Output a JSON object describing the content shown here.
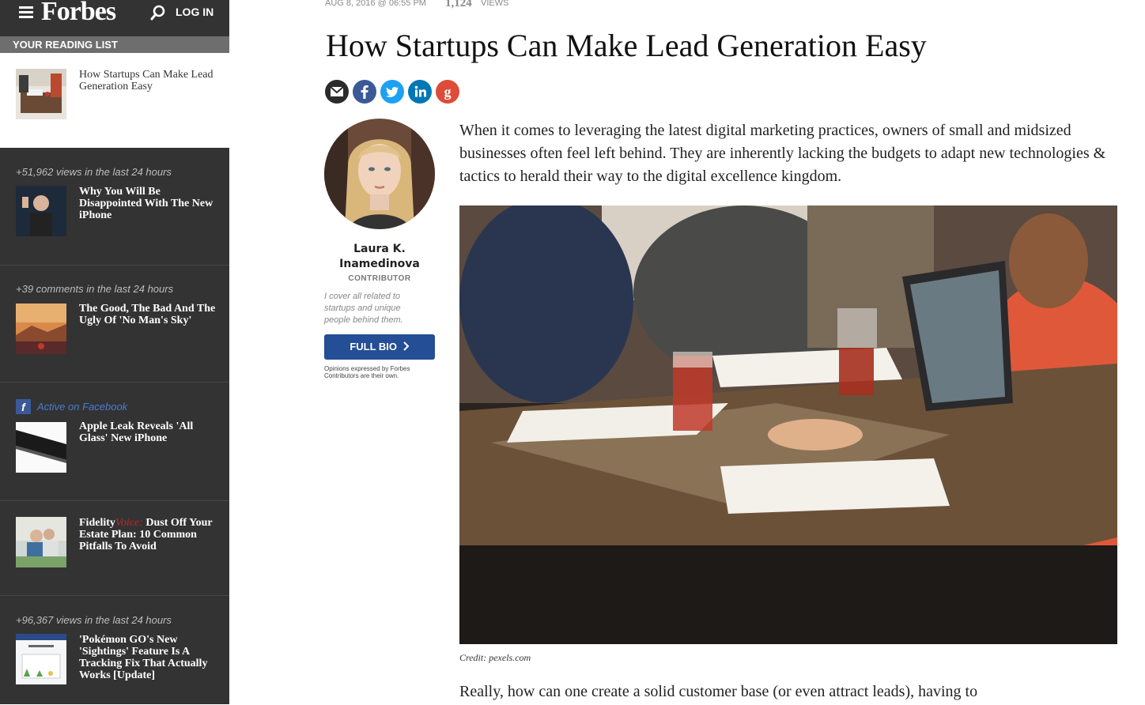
{
  "sidebar": {
    "logo": "Forbes",
    "login_label": "LOG IN",
    "reading_list_header": "YOUR READING LIST",
    "reading_list_item": "How Startups Can Make Lead Generation Easy",
    "sections": [
      {
        "meta": "+51,962 views in the last 24 hours",
        "title": "Why You Will Be Disappointed With The New iPhone"
      },
      {
        "meta": "+39 comments in the last 24 hours",
        "title": "The Good, The Bad And The Ugly Of 'No Man's Sky'"
      },
      {
        "meta": "Active on Facebook",
        "title": "Apple Leak Reveals 'All Glass' New iPhone"
      },
      {
        "title_brand": "Fidelity",
        "title_voice": "Voice:",
        "title_rest": " Dust Off Your Estate Plan: 10 Common Pitfalls To Avoid"
      },
      {
        "meta": "+96,367 views in the last 24 hours",
        "title": "'Pokémon GO's New 'Sightings' Feature Is A Tracking Fix That Actually Works [Update]"
      }
    ]
  },
  "article": {
    "date": "AUG 8, 2016 @ 06:55 PM",
    "views_count": "1,124",
    "views_label": "VIEWS",
    "headline": "How Startups Can Make Lead Generation Easy",
    "share_buttons": [
      "email-icon",
      "facebook-icon",
      "twitter-icon",
      "linkedin-icon",
      "google-plus-icon"
    ],
    "author": {
      "name_line1": "Laura K.",
      "name_line2": "Inamedinova",
      "role": "CONTRIBUTOR",
      "bio": "I cover all related to startups and unique people behind them.",
      "full_bio_label": "FULL BIO",
      "disclaimer": "Opinions expressed by Forbes Contributors are their own."
    },
    "intro": "When it comes to leveraging the latest digital marketing practices, owners of small and midsized businesses often feel left behind. They are inherently lacking the budgets to adapt new technologies & tactics to herald their way to the digital excellence kingdom.",
    "photo_credit": "Credit: pexels.com",
    "next_paragraph": "Really, how can one create a solid customer base (or even attract leads), having to"
  },
  "colors": {
    "sidebar_bg": "#333333",
    "reading_header_bg": "#6e6e6e",
    "full_bio_bg": "#244e95",
    "facebook": "#3b5998",
    "twitter": "#1da1f2",
    "linkedin": "#0077b5",
    "google": "#dd4b39",
    "voice_red": "#c0272d"
  }
}
